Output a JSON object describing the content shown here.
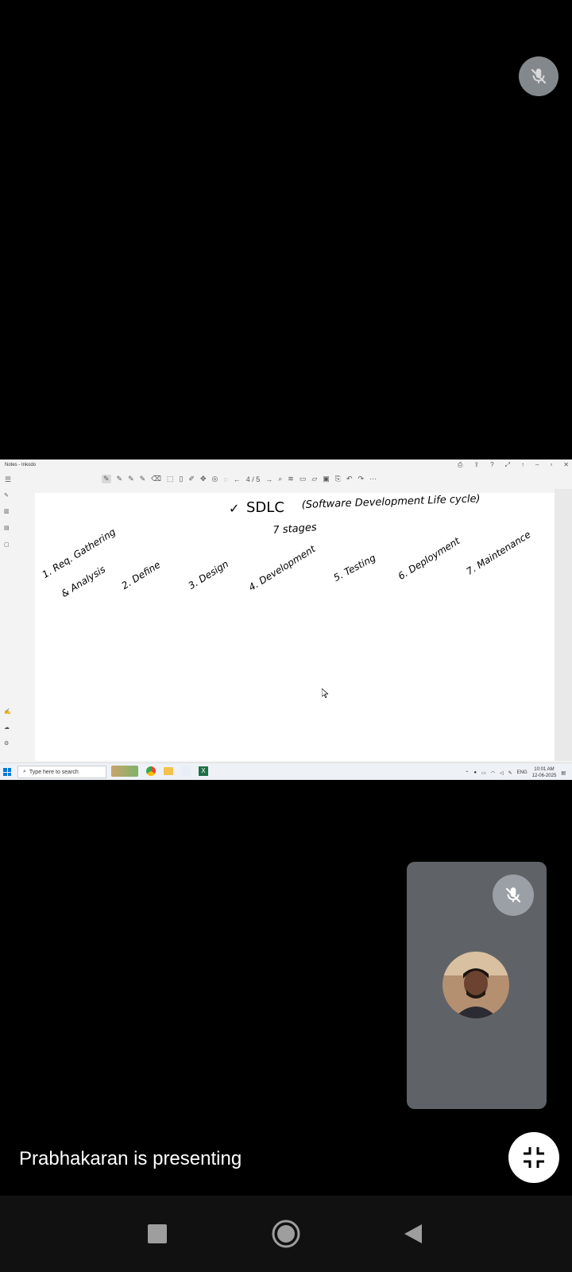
{
  "window": {
    "title": "Notes - Inkodo",
    "page_indicator": "4 / 5"
  },
  "notes": {
    "heading_check": "✓",
    "heading": "SDLC",
    "heading_paren": "(Software Development Life cycle)",
    "subheading": "7 stages",
    "stages": [
      "1. Req. Gathering",
      "& Analysis",
      "2. Define",
      "3. Design",
      "4. Development",
      "5. Testing",
      "6. Deployment",
      "7. Maintenance"
    ]
  },
  "taskbar": {
    "search_placeholder": "Type here to search",
    "language": "ENG",
    "time": "10:01 AM",
    "date": "12-06-2025"
  },
  "meeting": {
    "presenting_text": "Prabhakaran is presenting"
  },
  "icons": {
    "top_mic": "mic-off-icon",
    "tile_mic": "mic-off-icon",
    "fullscreen": "exit-fullscreen-icon",
    "nav": [
      "stop-icon",
      "home-icon",
      "back-icon"
    ]
  }
}
